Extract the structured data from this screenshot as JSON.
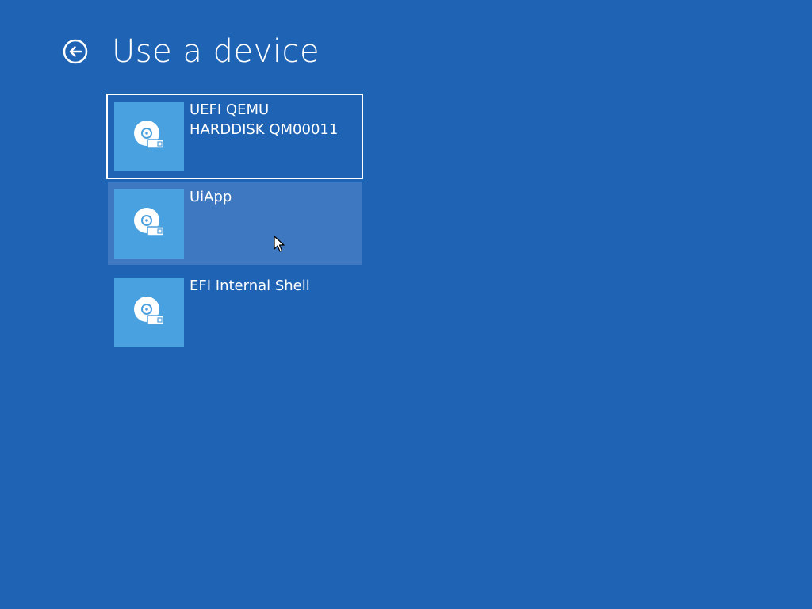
{
  "header": {
    "title": "Use a device",
    "back_icon": "back-arrow-circle-icon"
  },
  "devices": [
    {
      "label": "UEFI QEMU\nHARDDISK QM00011",
      "icon": "drive-icon",
      "state": "focused"
    },
    {
      "label": "UiApp",
      "icon": "drive-icon",
      "state": "hovered"
    },
    {
      "label": "EFI Internal Shell",
      "icon": "drive-icon",
      "state": "normal"
    }
  ],
  "colors": {
    "background": "#1f64b4",
    "tile_icon_bg": "#4aa1e0",
    "tile_hover_bg": "#3d78c0",
    "focus_border": "#ffffff"
  }
}
